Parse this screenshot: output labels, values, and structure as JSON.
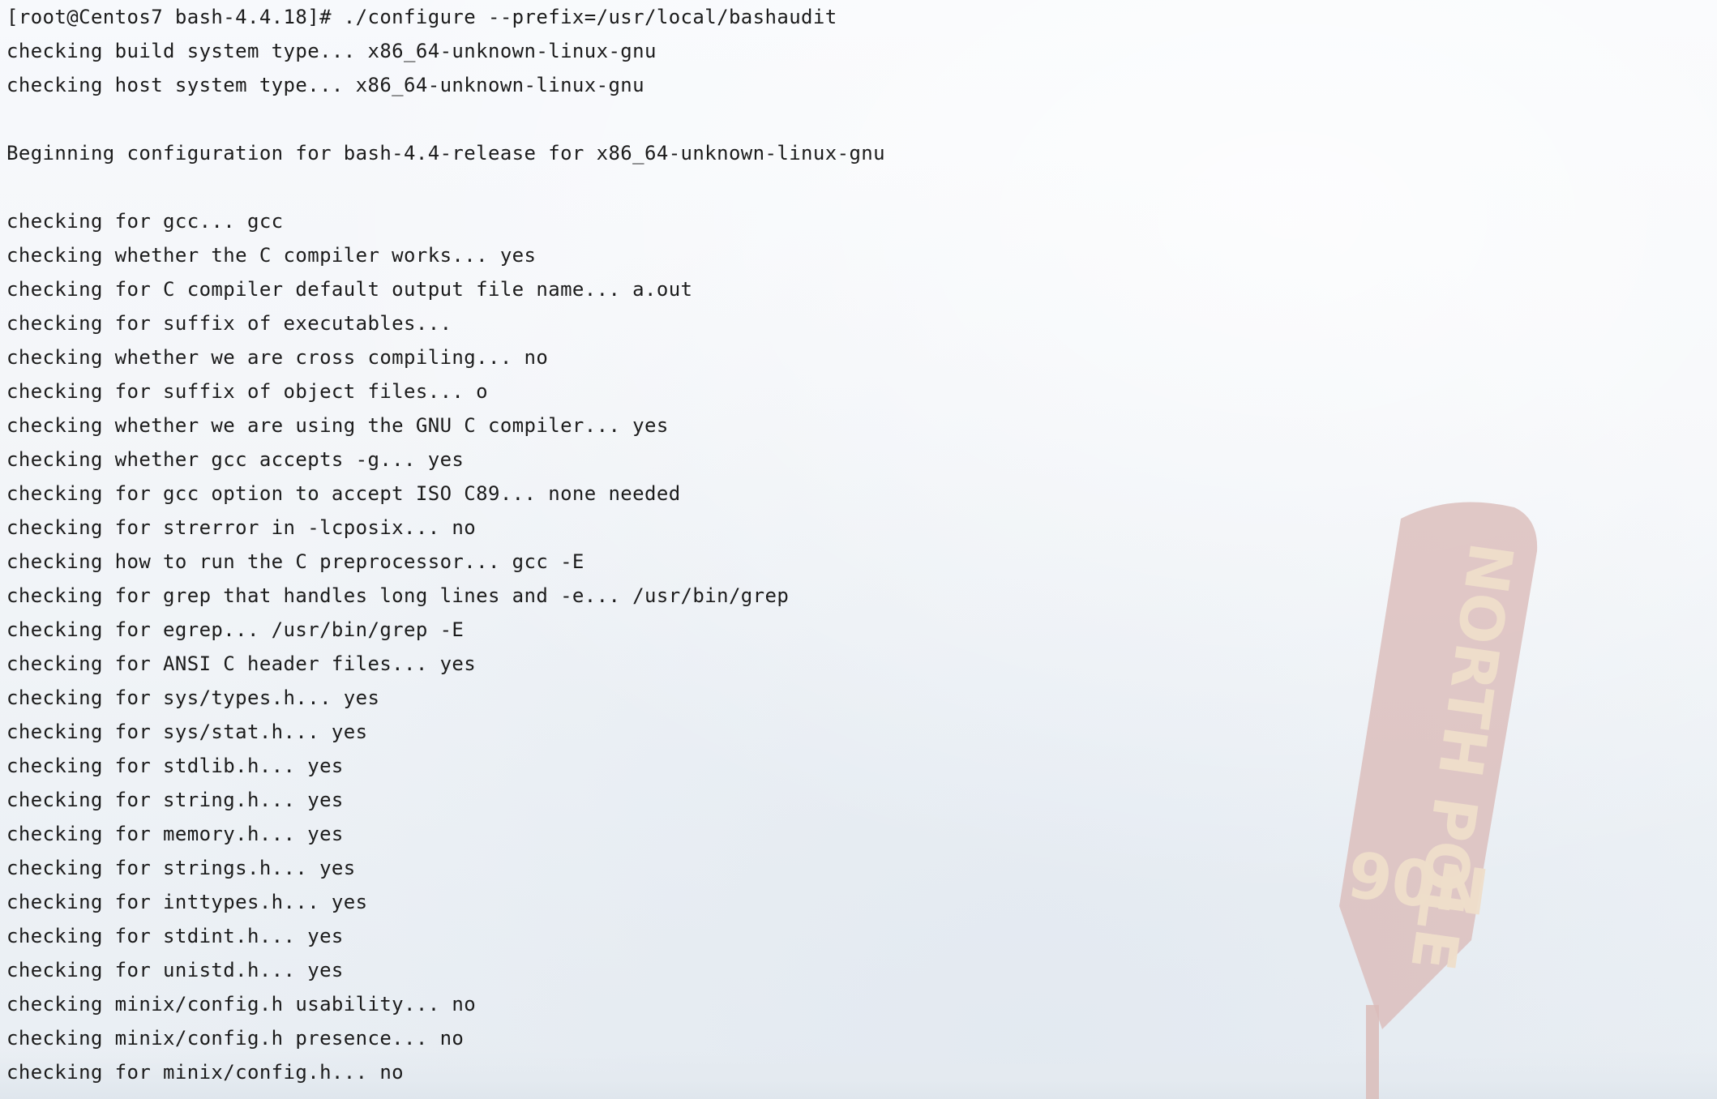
{
  "terminal": {
    "lines": [
      "[root@Centos7 bash-4.4.18]# ./configure --prefix=/usr/local/bashaudit",
      "checking build system type... x86_64-unknown-linux-gnu",
      "checking host system type... x86_64-unknown-linux-gnu",
      "",
      "Beginning configuration for bash-4.4-release for x86_64-unknown-linux-gnu",
      "",
      "checking for gcc... gcc",
      "checking whether the C compiler works... yes",
      "checking for C compiler default output file name... a.out",
      "checking for suffix of executables...",
      "checking whether we are cross compiling... no",
      "checking for suffix of object files... o",
      "checking whether we are using the GNU C compiler... yes",
      "checking whether gcc accepts -g... yes",
      "checking for gcc option to accept ISO C89... none needed",
      "checking for strerror in -lcposix... no",
      "checking how to run the C preprocessor... gcc -E",
      "checking for grep that handles long lines and -e... /usr/bin/grep",
      "checking for egrep... /usr/bin/grep -E",
      "checking for ANSI C header files... yes",
      "checking for sys/types.h... yes",
      "checking for sys/stat.h... yes",
      "checking for stdlib.h... yes",
      "checking for string.h... yes",
      "checking for memory.h... yes",
      "checking for strings.h... yes",
      "checking for inttypes.h... yes",
      "checking for stdint.h... yes",
      "checking for unistd.h... yes",
      "checking minix/config.h usability... no",
      "checking minix/config.h presence... no",
      "checking for minix/config.h... no"
    ]
  },
  "wallpaper": {
    "sign_text": "NORTH POLE",
    "sign_sub": "90N",
    "sign_color": "#d8b6b3",
    "sign_text_color": "#ecdcc9",
    "background_color": "#f3f6f9"
  }
}
